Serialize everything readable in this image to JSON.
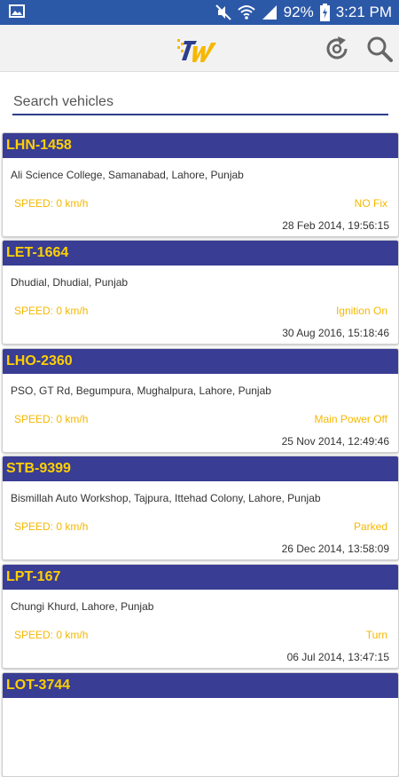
{
  "status_bar": {
    "battery": "92%",
    "time": "3:21 PM",
    "icons": [
      "gallery-notification-icon",
      "mute-icon",
      "wifi-icon",
      "signal-icon",
      "battery-charging-icon"
    ]
  },
  "app_bar": {
    "logo": "tw-logo",
    "actions": [
      "refresh-icon",
      "search-icon"
    ]
  },
  "search": {
    "placeholder": "Search vehicles",
    "value": ""
  },
  "colors": {
    "status_bar": "#2c58a8",
    "card_header": "#393d94",
    "accent_yellow": "#f5b800"
  },
  "vehicles": [
    {
      "plate": "LHN-1458",
      "address": "Ali Science College, Samanabad, Lahore, Punjab",
      "speed": "SPEED: 0 km/h",
      "status": "NO Fix",
      "time": "28 Feb 2014, 19:56:15"
    },
    {
      "plate": "LET-1664",
      "address": "Dhudial, Dhudial, Punjab",
      "speed": "SPEED: 0 km/h",
      "status": "Ignition On",
      "time": "30 Aug 2016, 15:18:46"
    },
    {
      "plate": "LHO-2360",
      "address": "PSO, GT Rd, Begumpura, Mughalpura, Lahore, Punjab",
      "speed": "SPEED: 0 km/h",
      "status": "Main Power Off",
      "time": "25 Nov 2014, 12:49:46"
    },
    {
      "plate": "STB-9399",
      "address": "Bismillah Auto Workshop, Tajpura, Ittehad Colony, Lahore, Punjab",
      "speed": "SPEED: 0 km/h",
      "status": "Parked",
      "time": "26 Dec 2014, 13:58:09"
    },
    {
      "plate": "LPT-167",
      "address": "Chungi Khurd, Lahore, Punjab",
      "speed": "SPEED: 0 km/h",
      "status": "Turn",
      "time": "06 Jul 2014, 13:47:15"
    },
    {
      "plate": "LOT-3744",
      "address": "",
      "speed": "",
      "status": "",
      "time": ""
    }
  ]
}
